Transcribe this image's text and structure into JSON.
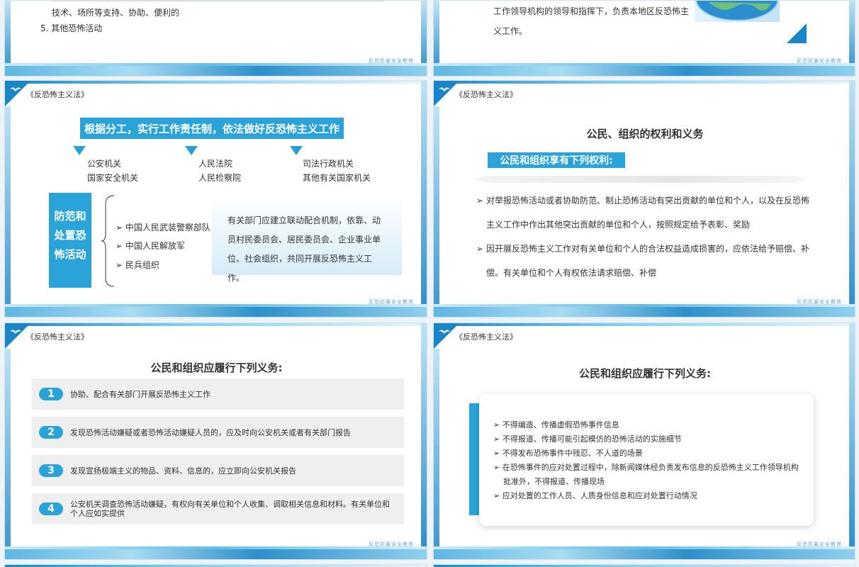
{
  "common": {
    "law_title": "《反恐怖主义法》",
    "footer": "反恐防暴安全教育"
  },
  "s1": {
    "partial_line": "技术、场所等支持、协助、便利的",
    "item5": "5.  其他恐怖活动"
  },
  "s2": {
    "line1": "工作领导机构的领导和指挥下，负责本地区反恐怖主",
    "line2": "义工作。"
  },
  "s3": {
    "banner": "根据分工，实行工作责任制，依法做好反恐怖主义工作",
    "col1": [
      "公安机关",
      "国家安全机关"
    ],
    "col2": [
      "人民法院",
      "人民检察院"
    ],
    "col3": [
      "司法行政机关",
      "其他有关国家机关"
    ],
    "side_label": "防范和处置恐怖活动",
    "forces": [
      "中国人民武装警察部队",
      "中国人民解放军",
      "民兵组织"
    ],
    "box_text": "有关部门应建立联动配合机制，依靠、动员村民委员会、居民委员会、企业事业单位、社会组织，共同开展反恐怖主义工作。"
  },
  "s4": {
    "title": "公民、组织的权利和义务",
    "subtitle": "公民和组织享有下列权利:",
    "items": [
      "对举报恐怖活动或者协助防范、制止恐怖活动有突出贡献的单位和个人，以及在反恐怖主义工作中作出其他突出贡献的单位和个人，按照规定给予表彰、奖励",
      "因开展反恐怖主义工作对有关单位和个人的合法权益造成损害的，应依法给予赔偿、补偿。有关单位和个人有权依法请求赔偿、补偿"
    ]
  },
  "s5": {
    "title": "公民和组织应履行下列义务:",
    "items": [
      {
        "num": "1",
        "text": "协助、配合有关部门开展反恐怖主义工作"
      },
      {
        "num": "2",
        "text": "发现恐怖活动嫌疑或者恐怖活动嫌疑人员的，应及时向公安机关或者有关部门报告"
      },
      {
        "num": "3",
        "text": "发现宣扬极端主义的物品、资料、信息的，应立即向公安机关报告"
      },
      {
        "num": "4",
        "text": "公安机关调查恐怖活动嫌疑，有权向有关单位和个人收集、调取相关信息和材料。有关单位和个人应如实提供"
      }
    ]
  },
  "s6": {
    "title": "公民和组织应履行下列义务:",
    "items": [
      "不得编造、传播虚假恐怖事件信息",
      "不得报道、传播可能引起模仿的恐怖活动的实施细节",
      "不得发布恐怖事件中残忍、不人道的场景",
      "在恐怖事件的应对处置过程中，除新闻媒体经负责发布信息的反恐怖主义工作领导机构批准外，不得报道、传播现场",
      "应对处置的工作人员、人质身份信息和应对处置行动情况"
    ]
  },
  "colors": {
    "accent": "#2a9fd6",
    "accent_dark": "#1a86c7",
    "banner_bg": "#2aa3d9"
  }
}
